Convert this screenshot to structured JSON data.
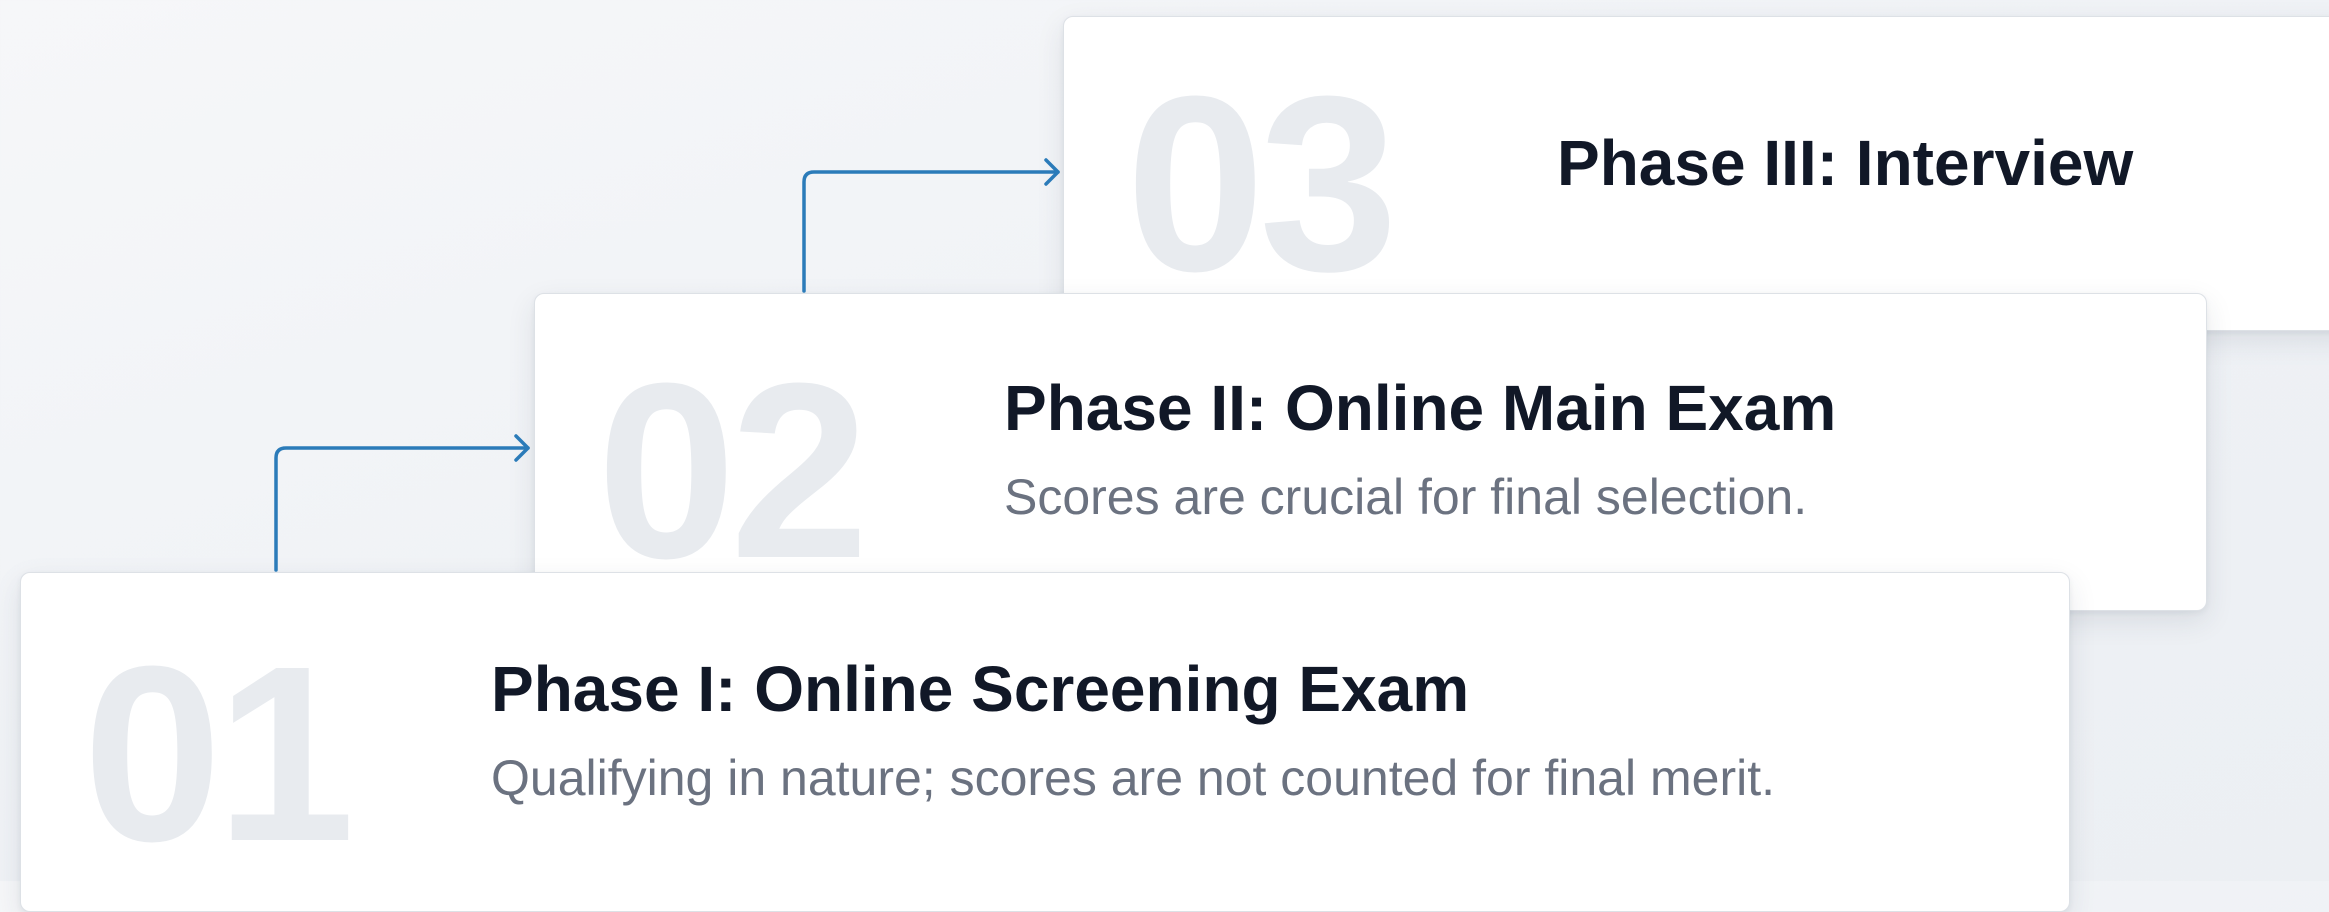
{
  "phases": [
    {
      "number": "01",
      "title": "Phase I: Online Screening Exam",
      "description": "Qualifying in nature; scores are not counted for final merit."
    },
    {
      "number": "02",
      "title": "Phase II: Online Main Exam",
      "description": "Scores are crucial for final selection."
    },
    {
      "number": "03",
      "title": "Phase III: Interview",
      "description": ""
    }
  ],
  "colors": {
    "connector": "#2b7bb9",
    "title": "#111827",
    "description": "#6b7280",
    "step_number": "#e8ebef",
    "card": "#ffffff"
  }
}
